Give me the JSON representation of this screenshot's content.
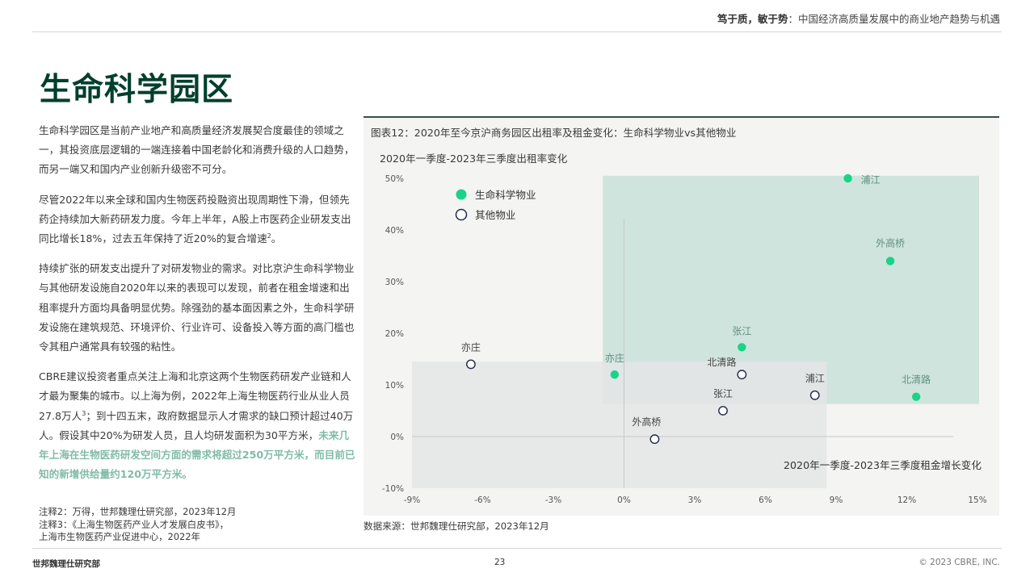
{
  "header": {
    "title_bold": "笃于质，敏于势",
    "title_sep": "：",
    "title_rest": "中国经济高质量发展中的商业地产趋势与机遇"
  },
  "page_title": "生命科学园区",
  "body": {
    "p1": "生命科学园区是当前产业地产和高质量经济发展契合度最佳的领域之一，其投资底层逻辑的一端连接着中国老龄化和消费升级的人口趋势，而另一端又和国内产业创新升级密不可分。",
    "p2": "尽管2022年以来全球和国内生物医药投融资出现周期性下滑，但领先药企持续加大新药研发力度。今年上半年，A股上市医药企业研发支出同比增长18%，过去五年保持了近20%的复合增速",
    "p2_sup": "2",
    "p2_end": "。",
    "p3": "持续扩张的研发支出提升了对研发物业的需求。对比京沪生命科学物业与其他研发设施自2020年以来的表现可以发现，前者在租金增速和出租率提升方面均具备明显优势。除强劲的基本面因素之外，生命科学研发设施在建筑规范、环境评价、行业许可、设备投入等方面的高门槛也令其租户通常具有较强的粘性。",
    "p4": "CBRE建议投资者重点关注上海和北京这两个生物医药研发产业链和人才最为聚集的城市。以上海为例，2022年上海生物医药行业从业人员27.8万人",
    "p4_sup": "3",
    "p4_mid": "；到十四五末，政府数据显示人才需求的缺口预计超过40万人。假设其中20%为研发人员，且人均研发面积为30平方米，",
    "p4_highlight": "未来几年上海在生物医药研发空间方面的需求将超过250万平方米，而目前已知的新增供给量约120万平方米。"
  },
  "notes": {
    "n1": "注释2：万得，世邦魏理仕研究部，2023年12月",
    "n2": "注释3：《上海生物医药产业人才发展白皮书》，",
    "n3": "上海市生物医药产业促进中心，2022年"
  },
  "chart": {
    "title": "图表12：2020年至今京沪商务园区出租率及租金变化：生命科学物业vs其他物业",
    "source": "数据来源：世邦魏理仕研究部，2023年12月"
  },
  "chart_data": {
    "type": "scatter",
    "title": "图表12：2020年至今京沪商务园区出租率及租金变化：生命科学物业vs其他物业",
    "xlabel": "2020年一季度-2023年三季度租金增长变化",
    "ylabel": "2020年一季度-2023年三季度出租率变化",
    "xlim": [
      -9,
      15
    ],
    "ylim": [
      -10,
      50
    ],
    "x_ticks": [
      "-9%",
      "-6%",
      "-3%",
      "0%",
      "3%",
      "6%",
      "9%",
      "12%",
      "15%"
    ],
    "y_ticks": [
      "-10%",
      "0%",
      "10%",
      "20%",
      "30%",
      "40%",
      "50%"
    ],
    "legend_position": "top-left",
    "colors": {
      "life_science": "#17d488",
      "other_stroke": "#1f2b4d",
      "life_region": "#cfe4dd",
      "other_region": "#e4e5e6",
      "life_label": "#5f8f7f",
      "other_label": "#444444"
    },
    "series": [
      {
        "name": "生命科学物业",
        "points": [
          {
            "label": "浦江",
            "x": 9.5,
            "y": 50
          },
          {
            "label": "外高桥",
            "x": 11.3,
            "y": 34
          },
          {
            "label": "张江",
            "x": 5.0,
            "y": 17.3
          },
          {
            "label": "亦庄",
            "x": -0.4,
            "y": 12
          },
          {
            "label": "北清路",
            "x": 12.4,
            "y": 7.7
          }
        ]
      },
      {
        "name": "其他物业",
        "points": [
          {
            "label": "亦庄",
            "x": -6.5,
            "y": 14
          },
          {
            "label": "北清路",
            "x": 5.0,
            "y": 12
          },
          {
            "label": "浦江",
            "x": 8.1,
            "y": 8
          },
          {
            "label": "张江",
            "x": 4.2,
            "y": 5
          },
          {
            "label": "外高桥",
            "x": 1.3,
            "y": -0.5
          }
        ]
      }
    ]
  },
  "footer": {
    "left": "世邦魏理仕研究部",
    "page": "23",
    "right": "© 2023 CBRE, INC."
  }
}
